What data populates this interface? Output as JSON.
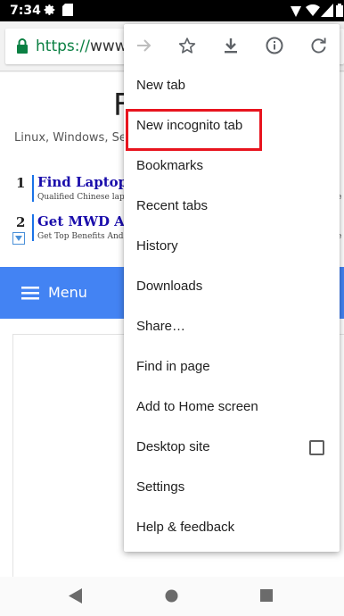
{
  "status_bar": {
    "time": "7:34"
  },
  "url_bar": {
    "scheme": "https://",
    "host": "www.po"
  },
  "page": {
    "site_initial": "F",
    "tagline": "Linux, Windows, Sec",
    "ads": [
      {
        "number": "1",
        "title": "Find Laptop in C",
        "subtitle": "Qualified Chinese laptop",
        "tail": "e"
      },
      {
        "number": "2",
        "title": "Get MWD Advis",
        "subtitle": "Get Top Benefits And Us",
        "tail": "e"
      }
    ],
    "menu_label": "Menu"
  },
  "overflow_menu": {
    "toolbar_icons": [
      "forward-icon",
      "bookmark-star-icon",
      "download-icon",
      "info-icon",
      "refresh-icon"
    ],
    "items": [
      {
        "label": "New tab"
      },
      {
        "label": "New incognito tab"
      },
      {
        "label": "Bookmarks"
      },
      {
        "label": "Recent tabs"
      },
      {
        "label": "History"
      },
      {
        "label": "Downloads"
      },
      {
        "label": "Share…"
      },
      {
        "label": "Find in page"
      },
      {
        "label": "Add to Home screen"
      },
      {
        "label": "Desktop site"
      },
      {
        "label": "Settings"
      },
      {
        "label": "Help & feedback"
      }
    ],
    "highlighted_item": "New incognito tab",
    "desktop_site_checked": false
  },
  "colors": {
    "accent_blue": "#4383f3",
    "highlight_red": "#e8141e",
    "secure_green": "#0b8043"
  }
}
